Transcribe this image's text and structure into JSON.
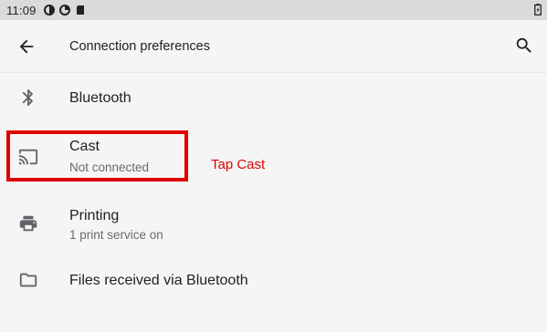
{
  "status_bar": {
    "time": "11:09",
    "icons": [
      "data-saver-icon",
      "data-saver-icon",
      "sd-card-icon"
    ],
    "right_icon": "battery-icon"
  },
  "app_bar": {
    "title": "Connection preferences",
    "back_icon": "arrow-back-icon",
    "search_icon": "search-icon"
  },
  "items": [
    {
      "icon": "bluetooth-icon",
      "title": "Bluetooth"
    },
    {
      "icon": "cast-icon",
      "title": "Cast",
      "summary": "Not connected"
    },
    {
      "icon": "print-icon",
      "title": "Printing",
      "summary": "1 print service on"
    },
    {
      "icon": "folder-icon",
      "title": "Files received via Bluetooth"
    }
  ],
  "annotation": {
    "text": "Tap Cast",
    "color": "#e00000"
  },
  "colors": {
    "background": "#f5f5f5",
    "status_bar": "#dadada",
    "icon": "#5f6368"
  }
}
